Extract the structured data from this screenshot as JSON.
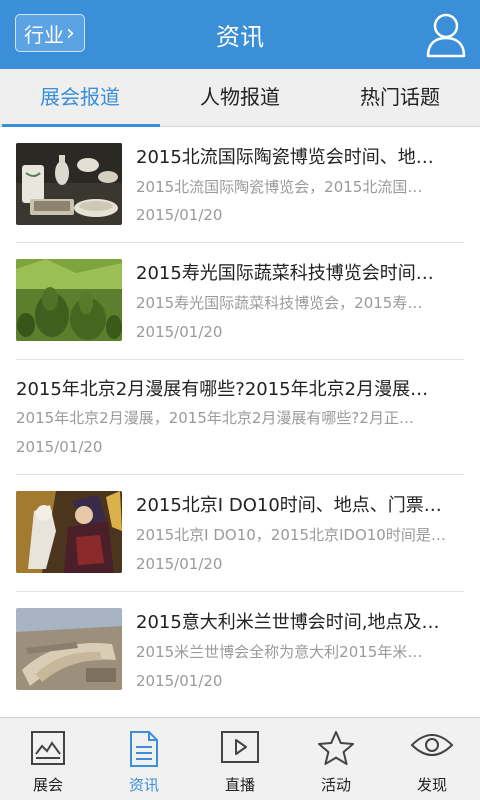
{
  "header": {
    "industry_label": "行业",
    "title": "资讯"
  },
  "tabs": [
    {
      "label": "展会报道",
      "active": true
    },
    {
      "label": "人物报道",
      "active": false
    },
    {
      "label": "热门话题",
      "active": false
    }
  ],
  "news": [
    {
      "title": "2015北流国际陶瓷博览会时间、地…",
      "summary": "2015北流国际陶瓷博览会，2015北流国…",
      "date": "2015/01/20",
      "image": "ceramics"
    },
    {
      "title": "2015寿光国际蔬菜科技博览会时间…",
      "summary": "2015寿光国际蔬菜科技博览会，2015寿…",
      "date": "2015/01/20",
      "image": "gourds"
    },
    {
      "title": "2015年北京2月漫展有哪些?2015年北京2月漫展…",
      "summary": "2015年北京2月漫展，2015年北京2月漫展有哪些?2月正…",
      "date": "2015/01/20",
      "image": null
    },
    {
      "title": "2015北京I DO10时间、地点、门票…",
      "summary": "2015北京I DO10，2015北京IDO10时间是…",
      "date": "2015/01/20",
      "image": "anime"
    },
    {
      "title": "2015意大利米兰世博会时间,地点及…",
      "summary": "2015米兰世博会全称为意大利2015年米…",
      "date": "2015/01/20",
      "image": "expo"
    }
  ],
  "bottom_nav": [
    {
      "label": "展会",
      "icon": "image-icon",
      "active": false
    },
    {
      "label": "资讯",
      "icon": "document-icon",
      "active": true
    },
    {
      "label": "直播",
      "icon": "play-icon",
      "active": false
    },
    {
      "label": "活动",
      "icon": "star-icon",
      "active": false
    },
    {
      "label": "发现",
      "icon": "eye-icon",
      "active": false
    }
  ],
  "colors": {
    "accent": "#3b8fd8",
    "header": "#3b8fd8"
  }
}
